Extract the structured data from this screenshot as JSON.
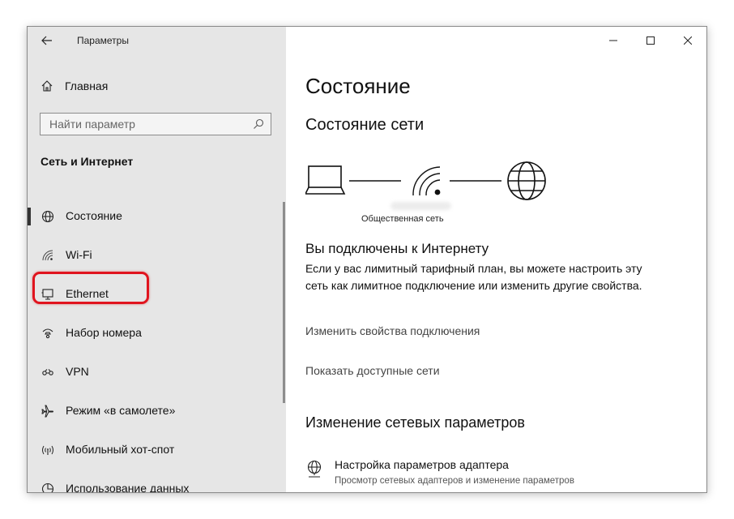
{
  "window": {
    "title": "Параметры",
    "controls": {
      "minimize": "minimize",
      "maximize": "maximize",
      "close": "close"
    }
  },
  "sidebar": {
    "home_label": "Главная",
    "search_placeholder": "Найти параметр",
    "section_title": "Сеть и Интернет",
    "items": [
      {
        "label": "Состояние",
        "icon": "globe-icon",
        "active": true
      },
      {
        "label": "Wi-Fi",
        "icon": "wifi-icon",
        "active": false
      },
      {
        "label": "Ethernet",
        "icon": "ethernet-icon",
        "active": false,
        "highlighted": true
      },
      {
        "label": "Набор номера",
        "icon": "dialup-icon",
        "active": false
      },
      {
        "label": "VPN",
        "icon": "vpn-icon",
        "active": false
      },
      {
        "label": "Режим «в самолете»",
        "icon": "airplane-icon",
        "active": false
      },
      {
        "label": "Мобильный хот-спот",
        "icon": "hotspot-icon",
        "active": false
      },
      {
        "label": "Использование данных",
        "icon": "data-usage-icon",
        "active": false
      }
    ]
  },
  "main": {
    "title": "Состояние",
    "network_status_heading": "Состояние сети",
    "network_type_label": "Общественная сеть",
    "connected_title": "Вы подключены к Интернету",
    "connected_desc": "Если у вас лимитный тарифный план, вы можете настроить эту сеть как лимитное подключение или изменить другие свойства.",
    "link_change_properties": "Изменить свойства подключения",
    "link_show_networks": "Показать доступные сети",
    "change_settings_heading": "Изменение сетевых параметров",
    "adapter_title": "Настройка параметров адаптера",
    "adapter_subtitle": "Просмотр сетевых адаптеров и изменение параметров"
  },
  "colors": {
    "sidebar_bg": "#e6e6e6",
    "highlight": "#e0141e",
    "text": "#111111"
  }
}
